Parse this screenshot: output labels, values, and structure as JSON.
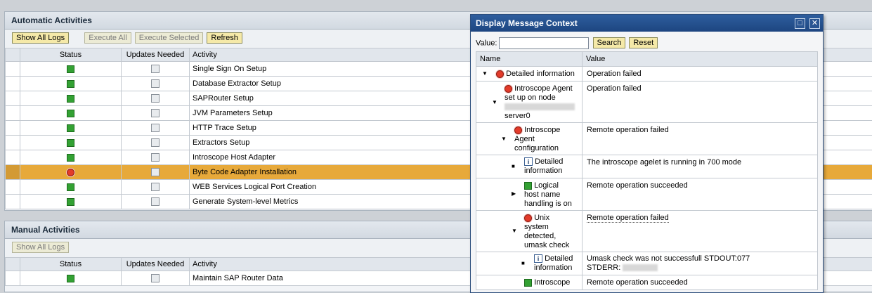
{
  "auto": {
    "title": "Automatic Activities",
    "buttons": {
      "show_all_logs": "Show All Logs",
      "execute_all": "Execute All",
      "execute_selected": "Execute Selected",
      "refresh": "Refresh"
    },
    "headers": {
      "status": "Status",
      "updates": "Updates Needed",
      "activity": "Activity"
    },
    "rows": [
      {
        "status": "green",
        "activity": "Single Sign On Setup"
      },
      {
        "status": "green",
        "activity": "Database Extractor Setup"
      },
      {
        "status": "green",
        "activity": "SAPRouter Setup"
      },
      {
        "status": "green",
        "activity": "JVM Parameters Setup"
      },
      {
        "status": "green",
        "activity": "HTTP Trace Setup"
      },
      {
        "status": "green",
        "activity": "Extractors Setup"
      },
      {
        "status": "green",
        "activity": "Introscope Host Adapter"
      },
      {
        "status": "red",
        "activity": "Byte Code Adapter Installation"
      },
      {
        "status": "green",
        "activity": "WEB Services Logical Port Creation"
      },
      {
        "status": "green",
        "activity": "Generate System-level Metrics"
      }
    ]
  },
  "manual": {
    "title": "Manual Activities",
    "buttons": {
      "show_all_logs": "Show All Logs"
    },
    "headers": {
      "status": "Status",
      "updates": "Updates Needed",
      "activity": "Activity"
    },
    "rows": [
      {
        "status": "green",
        "activity": "Maintain SAP Router Data"
      }
    ]
  },
  "dialog": {
    "title": "Display Message Context",
    "value_label": "Value:",
    "value_input": "",
    "search": "Search",
    "reset": "Reset",
    "headers": {
      "name": "Name",
      "value": "Value"
    },
    "nodes": {
      "n1": {
        "name": "Detailed information",
        "value": "Operation failed"
      },
      "n2": {
        "name1": "Introscope Agent",
        "name2": "set up on node",
        "name3": "server0",
        "value": "Operation failed"
      },
      "n3": {
        "name1": "Introscope",
        "name2": "Agent",
        "name3": "configuration",
        "value": "Remote operation failed"
      },
      "n4": {
        "name1": "Detailed",
        "name2": "information",
        "value": "The introscope agelet is running in 700 mode"
      },
      "n5": {
        "name1": "Logical",
        "name2": "host name",
        "name3": "handling is on",
        "value": "Remote operation succeeded"
      },
      "n6": {
        "name1": "Unix",
        "name2": "system",
        "name3": "detected,",
        "name4": "umask check",
        "value": "Remote operation failed"
      },
      "n7": {
        "name1": "Detailed",
        "name2": "information",
        "value1": "Umask check was not successfull STDOUT:077",
        "value2": "STDERR:"
      },
      "n8": {
        "name1": "Introscope",
        "value": "Remote operation succeeded"
      }
    },
    "colors": {
      "title_bg": "#1d4580",
      "highlight": "#e7a93a"
    }
  }
}
